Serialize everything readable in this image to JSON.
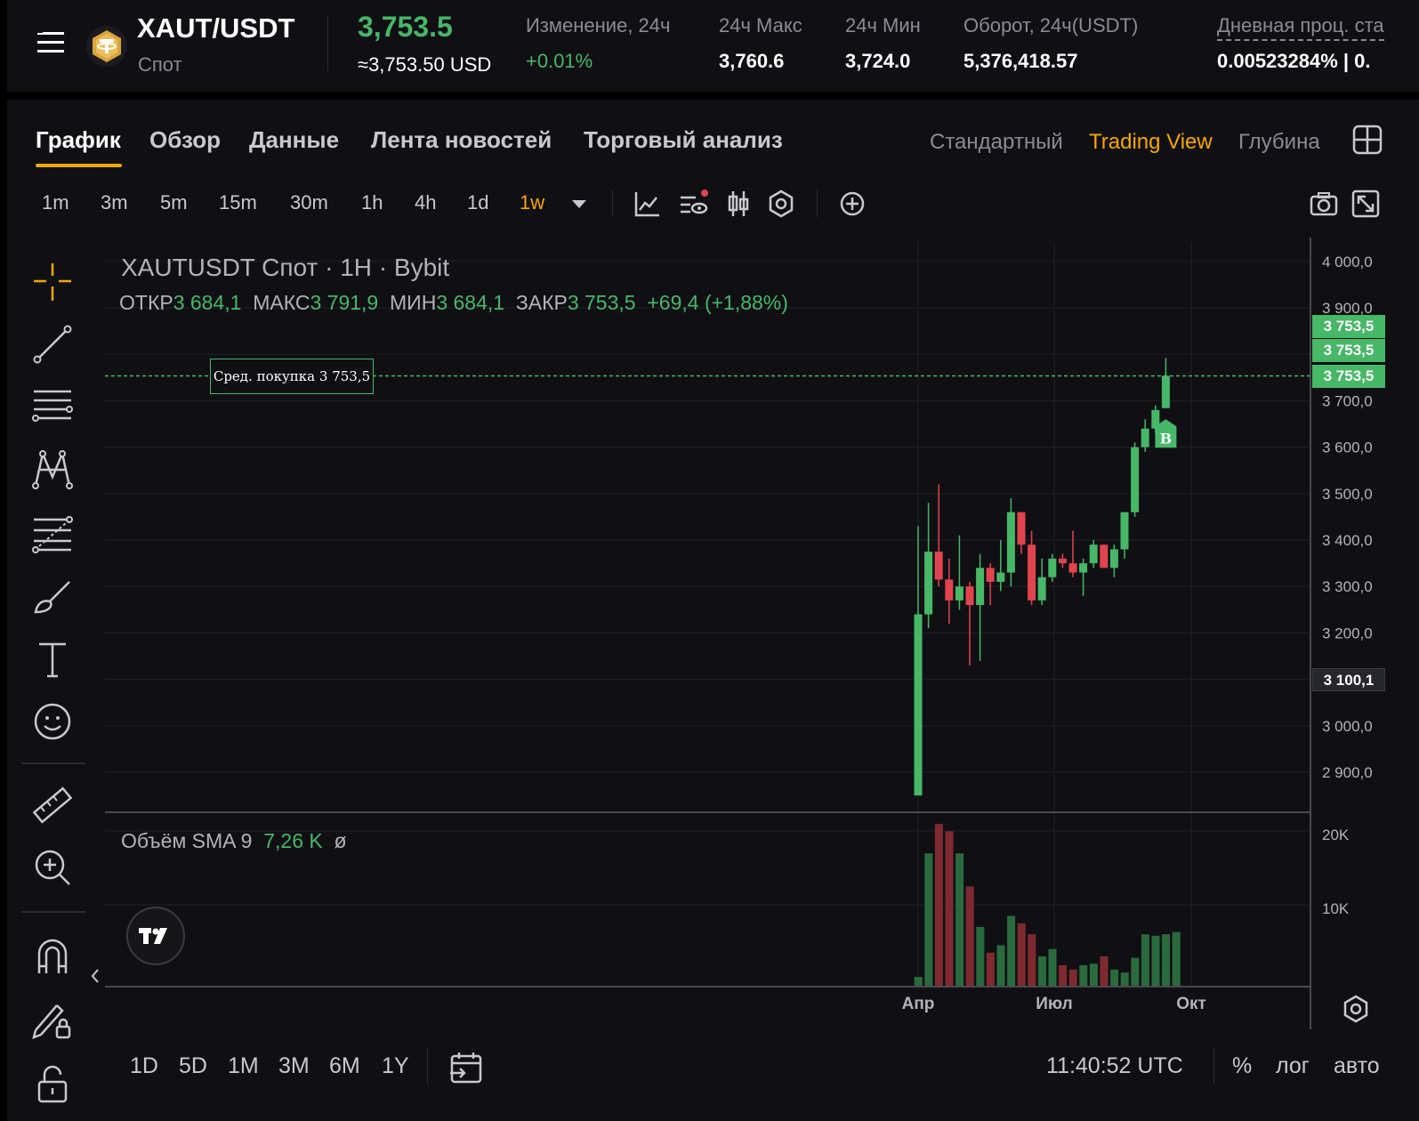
{
  "header": {
    "pair": "XAUT/USDT",
    "market": "Спот",
    "price": "3,753.5",
    "price_usd": "≈3,753.50 USD",
    "stats": [
      {
        "label": "Изменение, 24ч",
        "value": "+0.01%"
      },
      {
        "label": "24ч Макс",
        "value": "3,760.6"
      },
      {
        "label": "24ч Мин",
        "value": "3,724.0"
      },
      {
        "label": "Оборот, 24ч(USDT)",
        "value": "5,376,418.57"
      },
      {
        "label": "Дневная проц. ста",
        "value": "0.00523284% | 0."
      }
    ]
  },
  "tabs": [
    "График",
    "Обзор",
    "Данные",
    "Лента новостей",
    "Торговый анализ"
  ],
  "views": [
    "Стандартный",
    "Trading View",
    "Глубина"
  ],
  "timeframes": [
    "1m",
    "3m",
    "5m",
    "15m",
    "30m",
    "1h",
    "4h",
    "1d",
    "1w"
  ],
  "active_timeframe": "1w",
  "legend": {
    "title": "XAUTUSDT Спот · 1H · Bybit",
    "open_label": "ОТКР",
    "open": "3 684,1",
    "high_label": "МАКС",
    "high": "3 791,9",
    "low_label": "МИН",
    "low": "3 684,1",
    "close_label": "ЗАКР",
    "close": "3 753,5",
    "change": "+69,4 (+1,88%)"
  },
  "avg_buy": "Сред. покупка 3 753,5",
  "buy_marker": "B",
  "volume_legend": {
    "label": "Объём SMA 9",
    "value": "7,26 K",
    "symbol": "ø"
  },
  "price_tags": {
    "tag1": "3 753,5",
    "tag2": "3 753,5",
    "tag3": "3 753,5",
    "crosshair": "3 100,1"
  },
  "x_labels": [
    "Апр",
    "Июл",
    "Окт"
  ],
  "ranges": [
    "1D",
    "5D",
    "1M",
    "3M",
    "6M",
    "1Y"
  ],
  "clock": "11:40:52 UTC",
  "options": [
    "%",
    "лог",
    "авто"
  ],
  "colors": {
    "up": "#47b768",
    "down": "#e2444f",
    "accent": "#f7a600"
  },
  "chart_data": {
    "type": "candlestick",
    "price_axis": {
      "min": 2900,
      "max": 4000,
      "ticks": [
        "4 000,0",
        "3 900,0",
        "3 800,0",
        "3 700,0",
        "3 600,0",
        "3 500,0",
        "3 400,0",
        "3 300,0",
        "3 200,0",
        "3 100,0",
        "3 000,0",
        "2 900,0"
      ]
    },
    "volume_axis": {
      "ticks": [
        "20K",
        "10K"
      ]
    },
    "candles": [
      {
        "o": 2850,
        "h": 3430,
        "l": 2850,
        "c": 3240
      },
      {
        "o": 3240,
        "h": 3480,
        "l": 3210,
        "c": 3375
      },
      {
        "o": 3375,
        "h": 3520,
        "l": 3300,
        "c": 3315
      },
      {
        "o": 3315,
        "h": 3360,
        "l": 3220,
        "c": 3270
      },
      {
        "o": 3270,
        "h": 3410,
        "l": 3250,
        "c": 3300
      },
      {
        "o": 3300,
        "h": 3310,
        "l": 3130,
        "c": 3260
      },
      {
        "o": 3260,
        "h": 3370,
        "l": 3140,
        "c": 3340
      },
      {
        "o": 3340,
        "h": 3350,
        "l": 3260,
        "c": 3310
      },
      {
        "o": 3310,
        "h": 3400,
        "l": 3290,
        "c": 3330
      },
      {
        "o": 3330,
        "h": 3490,
        "l": 3300,
        "c": 3460
      },
      {
        "o": 3460,
        "h": 3460,
        "l": 3370,
        "c": 3390
      },
      {
        "o": 3390,
        "h": 3420,
        "l": 3260,
        "c": 3270
      },
      {
        "o": 3270,
        "h": 3360,
        "l": 3260,
        "c": 3320
      },
      {
        "o": 3320,
        "h": 3370,
        "l": 3310,
        "c": 3360
      },
      {
        "o": 3360,
        "h": 3370,
        "l": 3340,
        "c": 3350
      },
      {
        "o": 3350,
        "h": 3420,
        "l": 3320,
        "c": 3330
      },
      {
        "o": 3330,
        "h": 3360,
        "l": 3280,
        "c": 3350
      },
      {
        "o": 3350,
        "h": 3400,
        "l": 3340,
        "c": 3390
      },
      {
        "o": 3390,
        "h": 3390,
        "l": 3340,
        "c": 3340
      },
      {
        "o": 3340,
        "h": 3390,
        "l": 3320,
        "c": 3380
      },
      {
        "o": 3380,
        "h": 3460,
        "l": 3360,
        "c": 3460
      },
      {
        "o": 3460,
        "h": 3610,
        "l": 3450,
        "c": 3600
      },
      {
        "o": 3600,
        "h": 3660,
        "l": 3590,
        "c": 3640
      },
      {
        "o": 3640,
        "h": 3690,
        "l": 3630,
        "c": 3680
      },
      {
        "o": 3684.1,
        "h": 3791.9,
        "l": 3684.1,
        "c": 3753.5
      }
    ],
    "volumes": [
      1200,
      18000,
      22000,
      21000,
      18000,
      13500,
      8000,
      4500,
      5500,
      9500,
      8500,
      7000,
      4000,
      5000,
      2800,
      2200,
      2800,
      3000,
      4000,
      2200,
      1800,
      3800,
      7000,
      6800,
      7000,
      7300
    ],
    "avg_buy_price": 3753.5,
    "crosshair_price": 3100.1
  }
}
